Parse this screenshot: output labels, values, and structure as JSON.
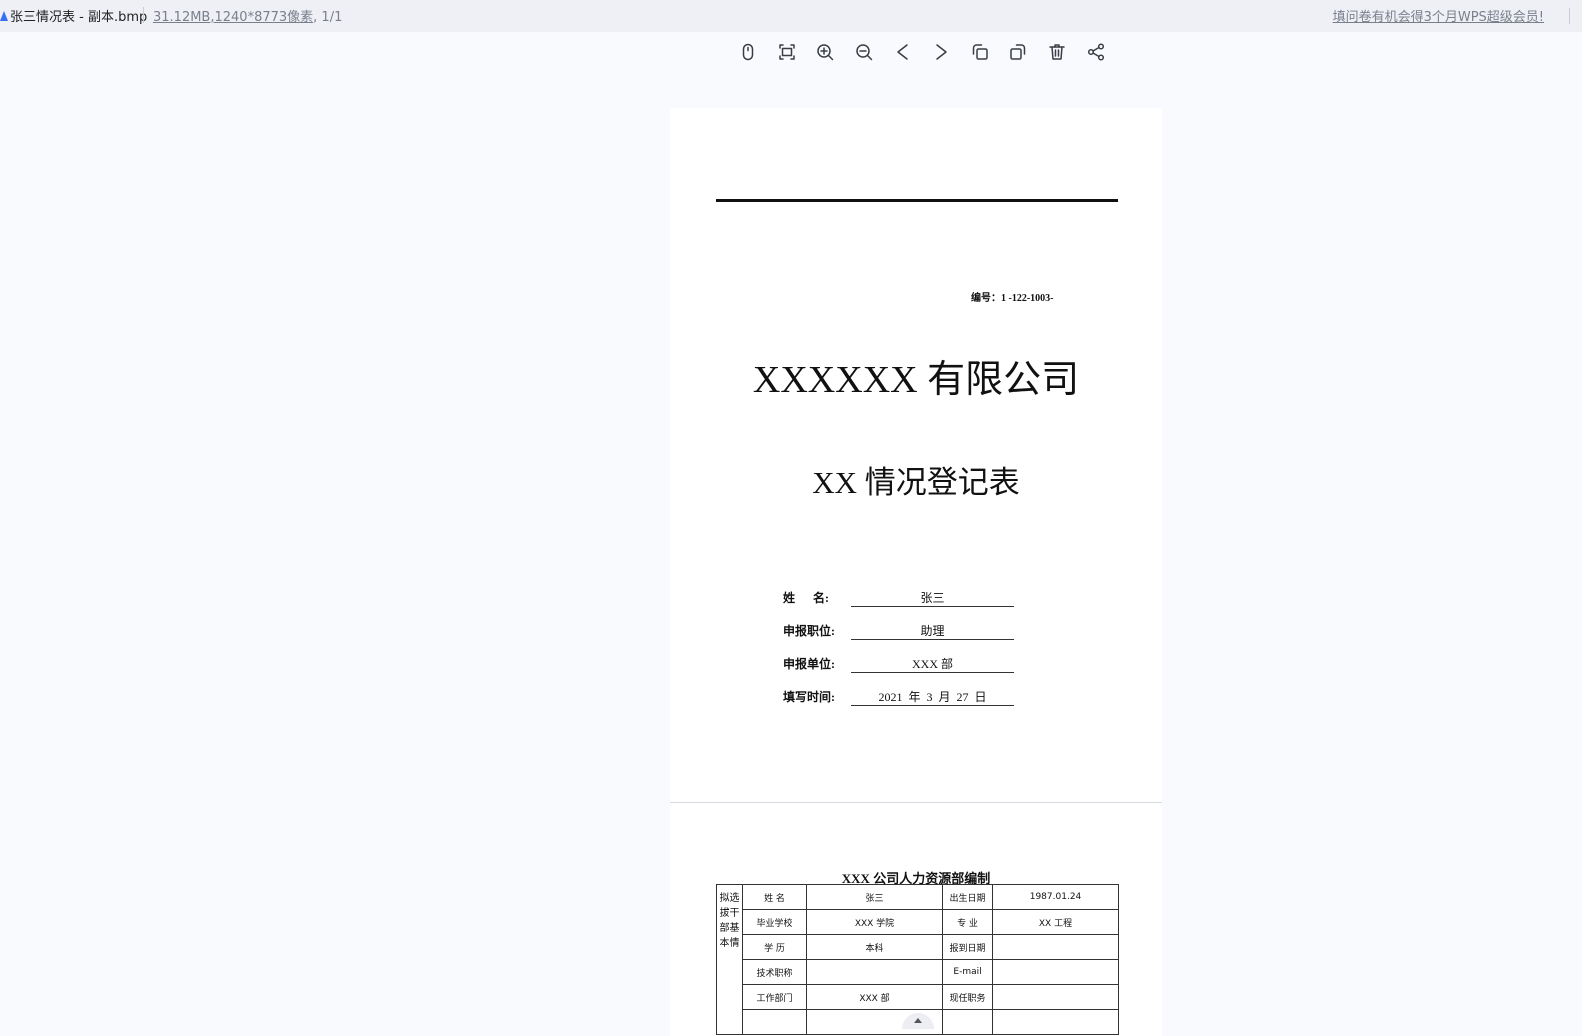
{
  "titlebar": {
    "file_name": "张三情况表 - 副本.bmp",
    "file_size": "31.12MB",
    "dimensions": ",1240*8773像素",
    "page_count": ", 1/1",
    "promo": "填问卷有机会得3个月WPS超级会员!"
  },
  "toolbar": {
    "icons": [
      "mouse-icon",
      "fit-screen-icon",
      "zoom-in-icon",
      "zoom-out-icon",
      "previous-icon",
      "next-icon",
      "rotate-left-icon",
      "rotate-right-icon",
      "delete-icon",
      "share-icon"
    ]
  },
  "document": {
    "serial": "编号：1 -122-1003-",
    "company": "XXXXXX 有限公司",
    "form_title": "XX 情况登记表",
    "fields": [
      {
        "label": "姓      名:",
        "value": "张三"
      },
      {
        "label": "申报职位:",
        "value": "助理"
      },
      {
        "label": "申报单位:",
        "value": "XXX 部"
      },
      {
        "label": "填写时间:",
        "value": "2021  年  3  月  27  日"
      }
    ],
    "dept_heading": "XXX 公司人力资源部编制",
    "table": {
      "side_label": "拟选拔干部基本情",
      "rows": [
        [
          "姓    名",
          "张三",
          "出生日期",
          "1987.01.24"
        ],
        [
          "毕业学校",
          "XXX 学院",
          "专    业",
          "XX 工程"
        ],
        [
          "学    历",
          "本科",
          "报到日期",
          ""
        ],
        [
          "技术职称",
          "",
          "E-mail",
          ""
        ],
        [
          "工作部门",
          "XXX 部",
          "现任职务",
          ""
        ]
      ]
    }
  },
  "colors": {
    "background": "#f9fafe",
    "titlebar": "#eef0f5",
    "page": "#ffffff",
    "muted_text": "#7a7f8c"
  }
}
